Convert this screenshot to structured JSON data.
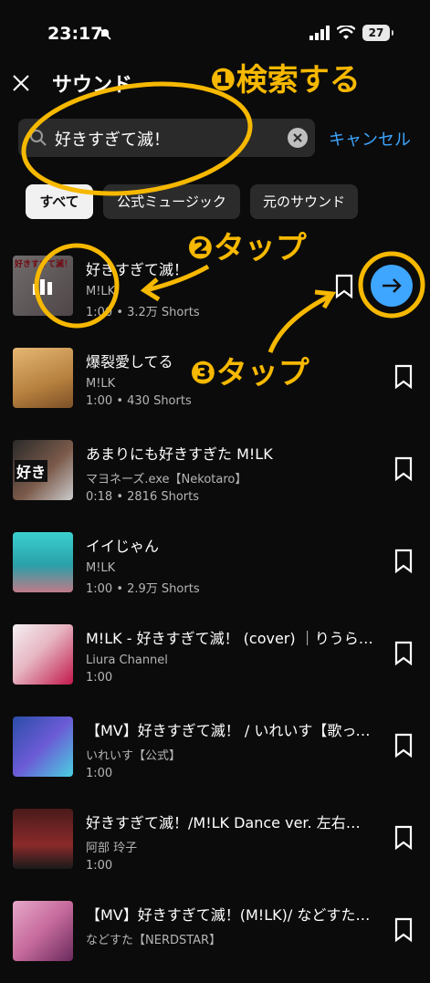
{
  "status": {
    "time": "23:17",
    "battery": "27"
  },
  "header": {
    "title": "サウンド"
  },
  "search": {
    "value": "好きすぎて滅！",
    "cancel": "キャンセル"
  },
  "chips": [
    "すべて",
    "公式ミュージック",
    "元のサウンド"
  ],
  "items": [
    {
      "title": "好きすぎて滅！",
      "artist": "M!LK",
      "stats": "1:00 • 3.2万 Shorts"
    },
    {
      "title": "爆裂愛してる",
      "artist": "M!LK",
      "stats": "1:00 • 430 Shorts"
    },
    {
      "title": "あまりにも好きすぎた M!LK",
      "artist": "マヨネーズ.exe【Nekotaro】",
      "stats": "0:18 • 2816 Shorts"
    },
    {
      "title": "イイじゃん",
      "artist": "M!LK",
      "stats": "1:00 • 2.9万 Shorts"
    },
    {
      "title": "M!LK - 好きすぎて滅！ (cover) ｜りうら【…",
      "artist": "Liura Channel",
      "stats": "1:00"
    },
    {
      "title": "【MV】好きすぎて滅！ / いれいす【歌ってみ…",
      "artist": "いれいす【公式】",
      "stats": "1:00"
    },
    {
      "title": "好きすぎて滅！/M!LK Dance ver. 左右反転",
      "artist": "阿部 玲子",
      "stats": "1:00"
    },
    {
      "title": "【MV】好きすぎて滅！(M!LK)/ などすた 歌…",
      "artist": "などすた【NERDSTAR】",
      "stats": ""
    }
  ],
  "thumbnail_text": {
    "item1": "好きすぎて滅！",
    "item3": "好き"
  },
  "annotations": {
    "step1": "❶検索する",
    "step2": "❷タップ",
    "step3": "❸タップ"
  },
  "colors": {
    "accent": "#3ea6ff",
    "annotation": "#f6b800",
    "background": "#0b0b0b"
  },
  "icons": [
    "close-icon",
    "search-icon",
    "clear-icon",
    "bookmark-icon",
    "arrow-right-icon",
    "bars-icon"
  ]
}
